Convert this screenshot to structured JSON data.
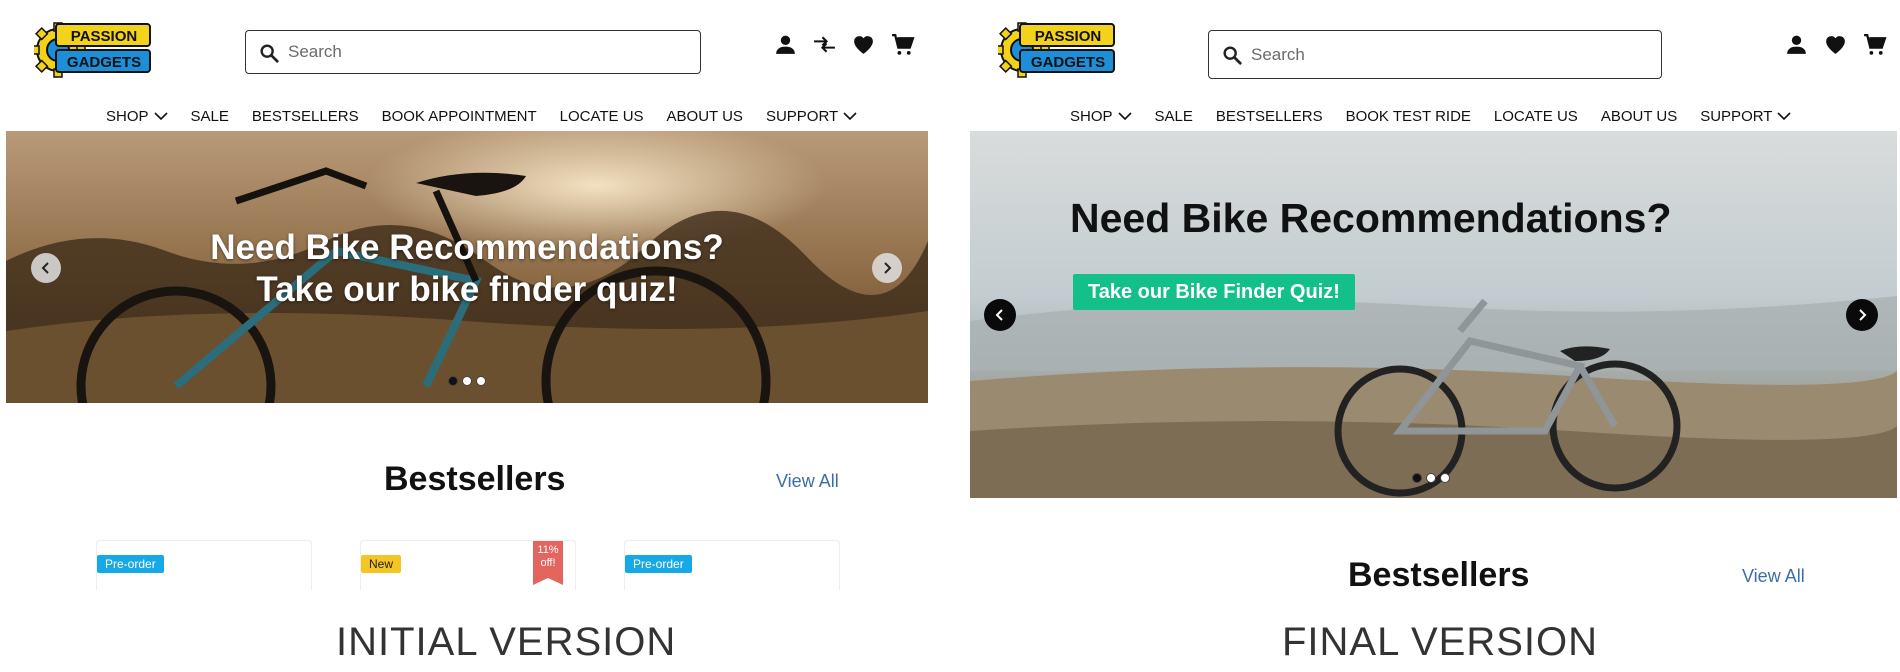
{
  "brand": {
    "logo_line1": "PASSION",
    "logo_line2": "GADGETS"
  },
  "colors": {
    "accent_green": "#14c08a",
    "link_blue": "#3b6ea8",
    "preorder_badge": "#17a9e6",
    "new_badge": "#f3c623",
    "discount_ribbon": "#e2655f"
  },
  "initial": {
    "search_placeholder": "Search",
    "header_icons": [
      "user-icon",
      "compare-icon",
      "heart-icon",
      "cart-icon"
    ],
    "nav": [
      "SHOP",
      "SALE",
      "BESTSELLERS",
      "BOOK APPOINTMENT",
      "LOCATE US",
      "ABOUT US",
      "SUPPORT"
    ],
    "hero": {
      "title_line1": "Need Bike Recommendations?",
      "title_line2": "Take our bike finder quiz!"
    },
    "bestsellers": {
      "title": "Bestsellers",
      "view_all": "View All"
    },
    "cards": [
      {
        "badge": "Pre-order"
      },
      {
        "badge": "New",
        "ribbon_line1": "11%",
        "ribbon_line2": "off!"
      },
      {
        "badge": "Pre-order"
      }
    ],
    "caption": "INITIAL VERSION"
  },
  "final": {
    "search_placeholder": "Search",
    "header_icons": [
      "user-icon",
      "heart-icon",
      "cart-icon"
    ],
    "nav": [
      "SHOP",
      "SALE",
      "BESTSELLERS",
      "BOOK TEST RIDE",
      "LOCATE US",
      "ABOUT US",
      "SUPPORT"
    ],
    "hero": {
      "title": "Need Bike Recommendations?",
      "cta": "Take our Bike Finder Quiz!"
    },
    "bestsellers": {
      "title": "Bestsellers",
      "view_all": "View All"
    },
    "caption": "FINAL VERSION"
  }
}
